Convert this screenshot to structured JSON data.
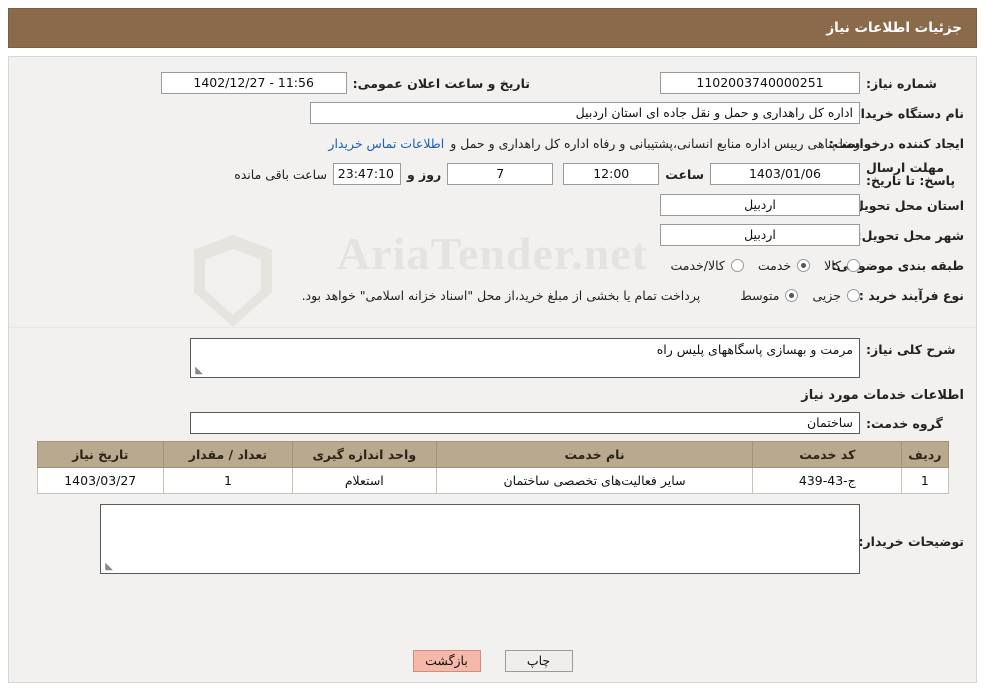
{
  "header": {
    "title": "جزئیات اطلاعات نیاز"
  },
  "watermark": {
    "text": "AriaTender.net"
  },
  "top": {
    "need_number_label": "شماره نیاز:",
    "need_number_value": "1102003740000251",
    "announce_datetime_label": "تاریخ و ساعت اعلان عمومی:",
    "announce_datetime_value": "11:56 - 1402/12/27",
    "buyer_org_label": "نام دستگاه خریدار:",
    "buyer_org_value": "اداره کل راهداری و حمل و نقل جاده ای استان اردبیل",
    "requester_label": "ایجاد کننده درخواست:",
    "requester_value": "رضا پناهی رییس اداره منابع انسانی،پشتیبانی و رفاه اداره کل راهداری و حمل و",
    "contact_link": "اطلاعات تماس خریدار",
    "deadline_label": "مهلت ارسال پاسخ: تا تاریخ:",
    "deadline_date": "1403/01/06",
    "hour_label": "ساعت",
    "deadline_time": "12:00",
    "days_value": "7",
    "days_and_label": "روز و",
    "countdown_value": "23:47:10",
    "remaining_label": "ساعت باقی مانده",
    "delivery_province_label": "استان محل تحویل:",
    "delivery_province_value": "اردبیل",
    "delivery_city_label": "شهر محل تحویل:",
    "delivery_city_value": "اردبیل",
    "category_label": "طبقه بندی موضوعی:",
    "category_options": [
      {
        "label": "کالا",
        "checked": false
      },
      {
        "label": "خدمت",
        "checked": true
      },
      {
        "label": "کالا/خدمت",
        "checked": false
      }
    ],
    "process_label": "نوع فرآیند خرید :",
    "process_options": [
      {
        "label": "جزیی",
        "checked": false
      },
      {
        "label": "متوسط",
        "checked": true
      }
    ],
    "process_note": "پرداخت تمام یا بخشی از مبلغ خرید،از محل \"اسناد خزانه اسلامی\" خواهد بود."
  },
  "mid": {
    "general_desc_label": "شرح کلی نیاز:",
    "general_desc_value": "مرمت و بهسازی پاسگاههای پلیس راه",
    "services_section_title": "اطلاعات خدمات مورد نیاز",
    "service_group_label": "گروه خدمت:",
    "service_group_value": "ساختمان",
    "buyer_notes_label": "توضیحات خریدار:",
    "buyer_notes_value": ""
  },
  "table": {
    "headers": [
      "ردیف",
      "کد خدمت",
      "نام خدمت",
      "واحد اندازه گیری",
      "تعداد / مقدار",
      "تاریخ نیاز"
    ],
    "rows": [
      [
        "1",
        "ج-43-439",
        "سایر فعالیت‌های تخصصی ساختمان",
        "استعلام",
        "1",
        "1403/03/27"
      ]
    ]
  },
  "buttons": {
    "print": "چاپ",
    "back": "بازگشت"
  },
  "colors": {
    "header_bg": "#8a6a4b",
    "panel_bg": "#f2f1f0",
    "table_header_bg": "#b9a98f",
    "link": "#1a5fb4",
    "accent_button": "#f6b8a8"
  }
}
